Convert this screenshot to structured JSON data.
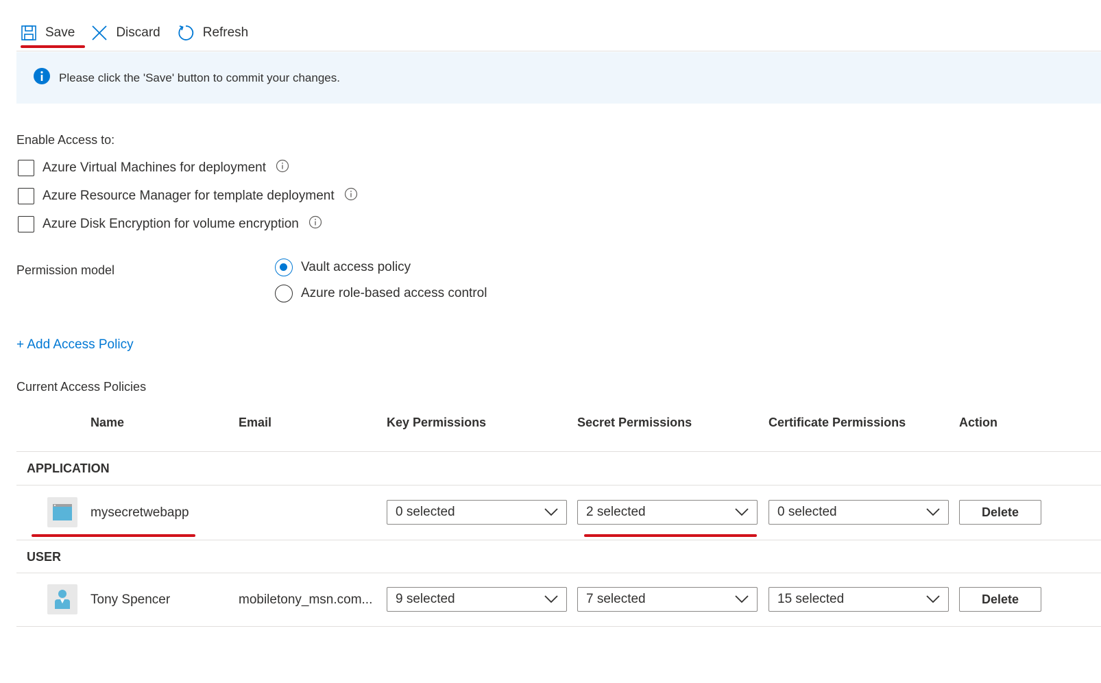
{
  "toolbar": {
    "save_label": "Save",
    "discard_label": "Discard",
    "refresh_label": "Refresh"
  },
  "info_bar": {
    "message": "Please click the 'Save' button to commit your changes."
  },
  "enable_access": {
    "label": "Enable Access to:",
    "options": [
      {
        "label": "Azure Virtual Machines for deployment",
        "checked": false
      },
      {
        "label": "Azure Resource Manager for template deployment",
        "checked": false
      },
      {
        "label": "Azure Disk Encryption for volume encryption",
        "checked": false
      }
    ]
  },
  "permission_model": {
    "label": "Permission model",
    "options": [
      {
        "label": "Vault access policy",
        "selected": true
      },
      {
        "label": "Azure role-based access control",
        "selected": false
      }
    ]
  },
  "add_policy_label": "+ Add Access Policy",
  "policies": {
    "title": "Current Access Policies",
    "columns": [
      "Name",
      "Email",
      "Key Permissions",
      "Secret Permissions",
      "Certificate Permissions",
      "Action"
    ],
    "groups": [
      {
        "label": "APPLICATION",
        "rows": [
          {
            "name": "mysecretwebapp",
            "email": "",
            "key": "0 selected",
            "secret": "2 selected",
            "certificate": "0 selected",
            "action": "Delete",
            "icon": "app-icon"
          }
        ]
      },
      {
        "label": "USER",
        "rows": [
          {
            "name": "Tony Spencer",
            "email": "mobiletony_msn.com...",
            "key": "9 selected",
            "secret": "7 selected",
            "certificate": "15 selected",
            "action": "Delete",
            "icon": "user-icon"
          }
        ]
      }
    ]
  },
  "colors": {
    "accent": "#0078d4",
    "highlight_underline": "#d1121b",
    "info_background": "#eff6fc"
  }
}
